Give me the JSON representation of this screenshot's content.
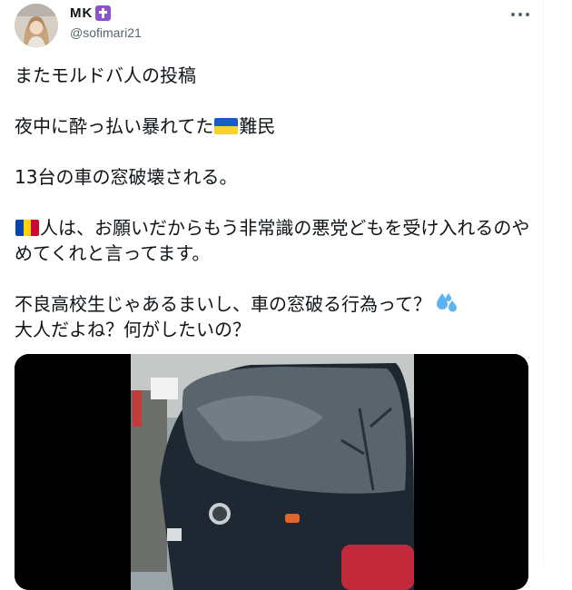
{
  "user": {
    "display_name": "MK",
    "badge_icon": "latin-cross-icon",
    "handle": "@sofimari21"
  },
  "tweet": {
    "line1": "またモルドバ人の投稿",
    "line2a": "夜中に酔っ払い暴れてた",
    "line2_flag": "ukraine-flag-icon",
    "line2b": "難民",
    "line3": "13台の車の窓破壊される。",
    "line4_flag": "moldova-flag-icon",
    "line4": "人は、お願いだからもう非常識の悪党どもを受け入れるのやめてくれと言ってます。",
    "line5": "不良高校生じゃあるまいし、車の窓破る行為って？",
    "line5_icon": "sweat-droplets-icon",
    "line6": "大人だよね？何がしたいの？"
  },
  "colors": {
    "text": "#0f1419",
    "secondary": "#536471",
    "ua_blue": "#1a5bcc",
    "ua_yellow": "#f8d22b",
    "md_blue": "#0046ae",
    "md_yellow": "#ffd200",
    "md_red": "#cc092f",
    "sweat": "#5db3f2"
  }
}
